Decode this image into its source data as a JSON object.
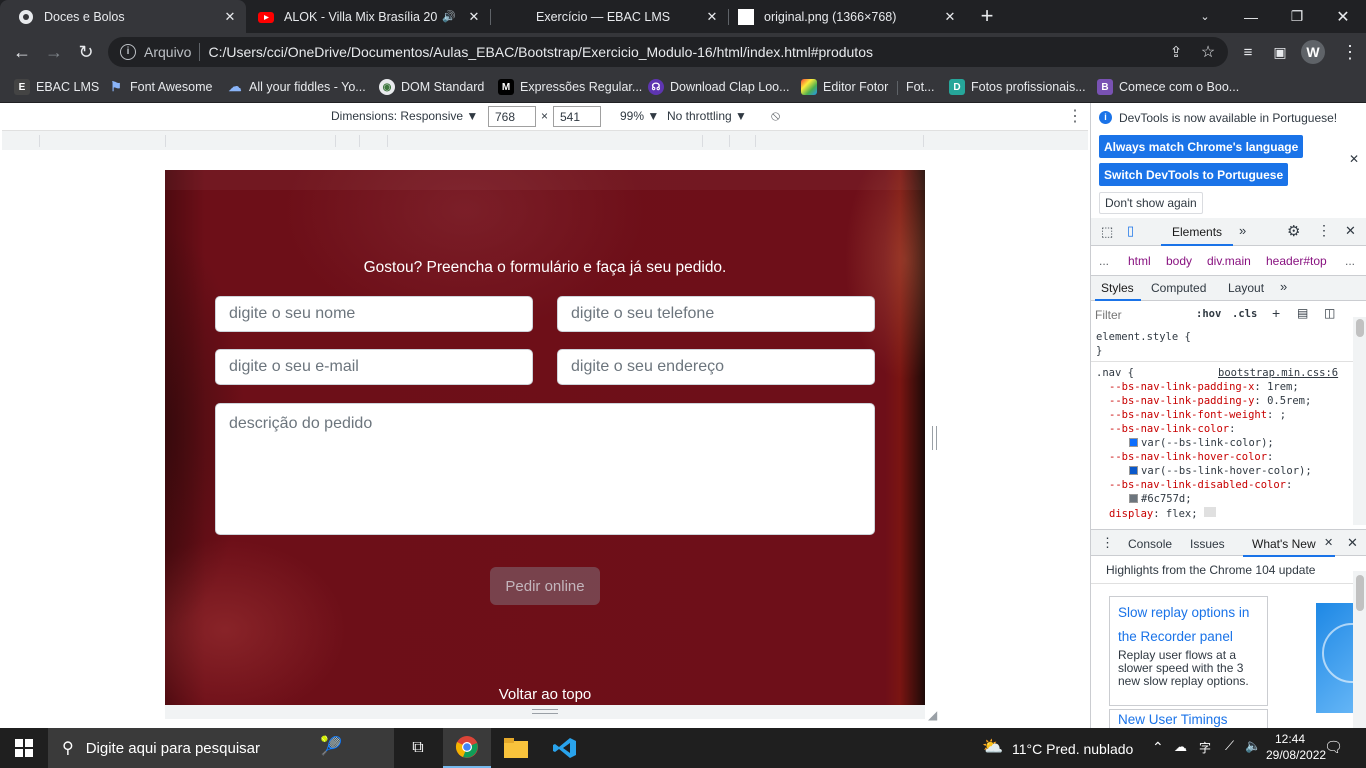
{
  "tabs": [
    {
      "title": "Doces e Bolos",
      "active": true
    },
    {
      "title": "ALOK - Villa Mix Brasília 2018",
      "active": false
    },
    {
      "title": "Exercício — EBAC LMS",
      "active": false
    },
    {
      "title": "original.png (1366×768)",
      "active": false
    }
  ],
  "toolbar": {
    "scheme_label": "Arquivo",
    "url": "C:/Users/cci/OneDrive/Documentos/Aulas_EBAC/Bootstrap/Exercicio_Modulo-16/html/index.html#produtos",
    "profile_initial": "W"
  },
  "bookmarks": [
    {
      "label": "EBAC LMS"
    },
    {
      "label": "Font Awesome"
    },
    {
      "label": "All your fiddles - Yo..."
    },
    {
      "label": "DOM Standard"
    },
    {
      "label": "Expressões Regular..."
    },
    {
      "label": "Download Clap Loo..."
    },
    {
      "label": "Editor Fotor"
    },
    {
      "label": "Fot..."
    },
    {
      "label": "Fotos profissionais..."
    },
    {
      "label": "Comece com o Boo..."
    }
  ],
  "device_toolbar": {
    "dimensions_label": "Dimensions: Responsive",
    "width": "768",
    "times": "×",
    "height": "541",
    "zoom": "99%",
    "throttle": "No throttling"
  },
  "site": {
    "form_title": "Gostou? Preencha o formulário e faça já seu pedido.",
    "name_placeholder": "digite o seu nome",
    "phone_placeholder": "digite o seu telefone",
    "email_placeholder": "digite o seu e-mail",
    "address_placeholder": "digite o seu endereço",
    "description_placeholder": "descrição do pedido",
    "submit_label": "Pedir online",
    "back_to_top": "Voltar ao topo"
  },
  "devtools": {
    "banner_text": "DevTools is now available in Portuguese!",
    "always_match": "Always match Chrome's language",
    "switch_pt": "Switch DevTools to Portuguese",
    "dont_show": "Don't show again",
    "main_tab": "Elements",
    "breadcrumbs": [
      "...",
      "html",
      "body",
      "div.main",
      "header#top",
      "..."
    ],
    "styles_tabs": [
      "Styles",
      "Computed",
      "Layout"
    ],
    "filter_placeholder": "Filter",
    "hov": ":hov",
    "cls": ".cls",
    "code": {
      "element_style": "element.style {",
      "close_brace": "}",
      "nav_selector": ".nav {",
      "source": "bootstrap.min.css:6",
      "l1_prop": "--bs-nav-link-padding-x",
      "l1_val": "1rem;",
      "l2_prop": "--bs-nav-link-padding-y",
      "l2_val": "0.5rem;",
      "l3_prop": "--bs-nav-link-font-weight",
      "l3_val": ";",
      "l4_prop": "--bs-nav-link-color",
      "l4_val": "var(--bs-link-color);",
      "l5_prop": "--bs-nav-link-hover-color",
      "l5_val": "var(--bs-link-hover-color);",
      "l6_prop": "--bs-nav-link-disabled-color",
      "l6_val": "#6c757d;",
      "l7_prop": "display",
      "l7_val": "flex;"
    },
    "drawer_tabs": [
      "Console",
      "Issues",
      "What's New"
    ],
    "whats_new_heading": "Highlights from the Chrome 104 update",
    "card1_title": "Slow replay options in the Recorder panel",
    "card1_body": "Replay user flows at a slower speed with the 3 new slow replay options.",
    "card2_title": "New User Timings"
  },
  "taskbar": {
    "search_placeholder": "Digite aqui para pesquisar",
    "weather": "11°C  Pred. nublado",
    "time": "12:44",
    "date": "29/08/2022"
  },
  "colors": {
    "accent": "#1a73e8",
    "chrome_dark": "#202124",
    "toolbar": "#35363a",
    "site_bg": "#6d0f18"
  }
}
